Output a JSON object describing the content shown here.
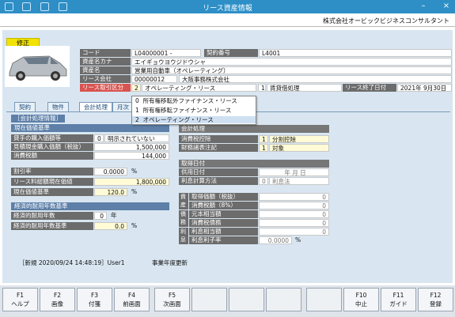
{
  "window": {
    "title": "リース資産情報",
    "company": "株式会社オービックビジネスコンサルタント"
  },
  "mode_badge": "修正",
  "header": {
    "code_label": "コード",
    "code_value": "L04000001 -",
    "contract_no_label": "契約番号",
    "contract_no_value": "L4001",
    "kana_label": "資産名カナ",
    "kana_value": "エイギョウヨウジドウシャ",
    "name_label": "資産名",
    "name_value": "営業用自動車（オペレーティング）",
    "lessor_label": "リース会社",
    "lessor_code": "00000012",
    "lessor_name": "大阪事務株式会社",
    "type_label": "リース取引区分",
    "type_code": "2",
    "type_name": "オペレーティング・リース",
    "accounting_code": "1",
    "accounting_name": "賃貸借処理",
    "end_label": "リース終了日付",
    "end_value": "2021年  9月30日"
  },
  "dropdown": {
    "items": [
      {
        "code": "0",
        "label": "所有権移転外ファイナンス・リース"
      },
      {
        "code": "1",
        "label": "所有権移転ファイナンス・リース"
      },
      {
        "code": "2",
        "label": "オペレーティング・リース"
      }
    ]
  },
  "tabs": [
    "契約",
    "物件",
    "会計処理",
    "月次"
  ],
  "left": {
    "section_title": "［会計処理情報］",
    "present_value_header": "現在価値基準",
    "borrower_rate_label": "貸手の購入価額等",
    "borrower_rate_code": "0",
    "borrower_rate_text": "明示されていない",
    "estimate_label": "見積現金購入価額（税抜）",
    "estimate_value": "1,500,000",
    "tax_label": "消費税額",
    "tax_value": "144,000",
    "discount_label": "割引率",
    "discount_value": "0.0000",
    "discount_unit": "%",
    "lease_total_label": "リース料総額現在価値",
    "lease_total_value": "1,800,000",
    "pv_base_label": "現在価値基準",
    "pv_base_value": "120.0",
    "pv_base_unit": "%",
    "useful_header": "経済的耐用年数基準",
    "useful_years_label": "経済的耐用年数",
    "useful_years_value": "0",
    "useful_years_unit": "年",
    "useful_base_label": "経済的耐用年数基準",
    "useful_base_value": "0.0",
    "useful_base_unit": "%"
  },
  "right": {
    "accounting_header": "会計処理",
    "tax_treatment_label": "消費税控除",
    "tax_treatment_code": "1",
    "tax_treatment_name": "分割控除",
    "fin_label": "財務諸表注記",
    "fin_code": "1",
    "fin_name": "対象",
    "acq_header": "取得日付",
    "use_date_label": "供用日付",
    "use_date_value": "年    月    日",
    "interest_label": "利息計算方法",
    "interest_code": "0",
    "interest_name": "利息法",
    "asset_side": "資産",
    "debt_side": "債務",
    "interest_side": "利息",
    "acq_price_label": "取得価額（税抜）",
    "acq_price_value": "0",
    "consumption_label": "消費税額（8%）",
    "consumption_value": "0",
    "principal_label": "元本相当額",
    "principal_value": "0",
    "tax_debt_label": "消費税債務",
    "tax_debt_value": "0",
    "interest_amt_label": "利息相当額",
    "interest_amt_value": "0",
    "interest_rate_label": "利息利子率",
    "interest_rate_value": "0.0000",
    "interest_rate_unit": "%"
  },
  "status": {
    "created": "［新規  2020/09/24 14:48:19］User1",
    "note": "事業年度更新"
  },
  "fkeys": [
    {
      "key": "F1",
      "label": "ヘルプ"
    },
    {
      "key": "F2",
      "label": "画像"
    },
    {
      "key": "F3",
      "label": "付箋"
    },
    {
      "key": "F4",
      "label": "前画面"
    },
    {
      "key": "F5",
      "label": "次画面"
    },
    {
      "key": "",
      "label": ""
    },
    {
      "key": "",
      "label": ""
    },
    {
      "key": "",
      "label": ""
    },
    {
      "key": "",
      "label": ""
    },
    {
      "key": "F10",
      "label": "中止"
    },
    {
      "key": "F11",
      "label": "ガイド"
    },
    {
      "key": "F12",
      "label": "登録"
    }
  ]
}
